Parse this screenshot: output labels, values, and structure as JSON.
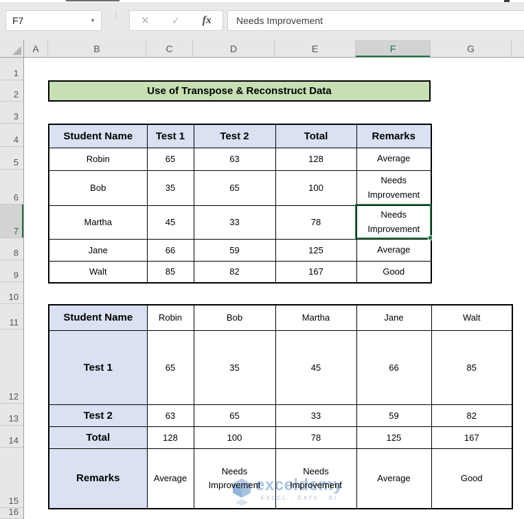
{
  "formula_bar": {
    "name_box": "F7",
    "cancel_icon": "✕",
    "enter_icon": "✓",
    "fx_label": "fx",
    "value": "Needs Improvement"
  },
  "grid": {
    "column_letters": [
      "A",
      "B",
      "C",
      "D",
      "E",
      "F",
      "G"
    ],
    "row_numbers": [
      "1",
      "2",
      "3",
      "4",
      "5",
      "6",
      "7",
      "8",
      "9",
      "10",
      "11",
      "12",
      "13",
      "14",
      "15",
      "16"
    ],
    "selected_cell": "F7",
    "selected_column": "F",
    "selected_row": "7"
  },
  "banner": {
    "title": "Use of Transpose & Reconstruct Data"
  },
  "table1": {
    "headers": [
      "Student Name",
      "Test 1",
      "Test 2",
      "Total",
      "Remarks"
    ],
    "rows": [
      [
        "Robin",
        "65",
        "63",
        "128",
        "Average"
      ],
      [
        "Bob",
        "35",
        "65",
        "100",
        "Needs Improvement"
      ],
      [
        "Martha",
        "45",
        "33",
        "78",
        "Needs Improvement"
      ],
      [
        "Jane",
        "66",
        "59",
        "125",
        "Average"
      ],
      [
        "Walt",
        "85",
        "82",
        "167",
        "Good"
      ]
    ]
  },
  "table2": {
    "header_label": "Student Name",
    "columns": [
      "Robin",
      "Bob",
      "Martha",
      "Jane",
      "Walt"
    ],
    "rows": [
      {
        "label": "Test 1",
        "values": [
          "65",
          "35",
          "45",
          "66",
          "85"
        ]
      },
      {
        "label": "Test 2",
        "values": [
          "63",
          "65",
          "33",
          "59",
          "82"
        ]
      },
      {
        "label": "Total",
        "values": [
          "128",
          "100",
          "78",
          "125",
          "167"
        ]
      },
      {
        "label": "Remarks",
        "values": [
          "Average",
          "Needs Improvement",
          "Needs Improvement",
          "Average",
          "Good"
        ]
      }
    ]
  },
  "watermark": {
    "brand": "exceldemy",
    "tagline": "EXCEL · DATA · BI"
  },
  "colors": {
    "accent_green": "#217346",
    "banner_bg": "#C6E0B4",
    "table_header_bg": "#D9E1F2"
  }
}
